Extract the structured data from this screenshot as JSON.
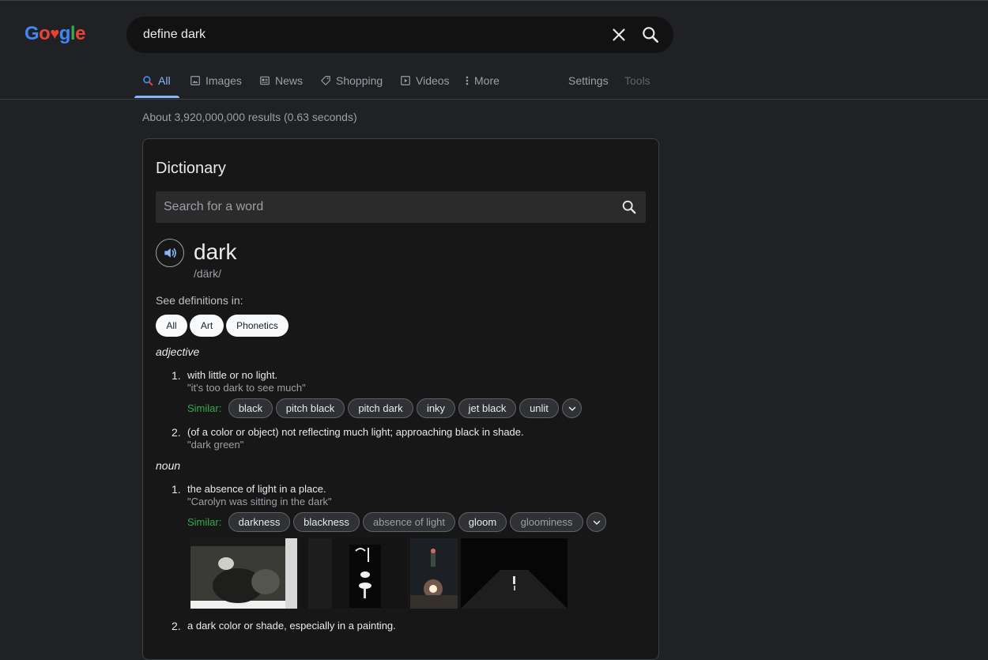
{
  "search": {
    "query": "define dark"
  },
  "tabs": [
    {
      "label": "All",
      "icon": "search-icon"
    },
    {
      "label": "Images",
      "icon": "image-icon"
    },
    {
      "label": "News",
      "icon": "news-icon"
    },
    {
      "label": "Shopping",
      "icon": "tag-icon"
    },
    {
      "label": "Videos",
      "icon": "play-icon"
    },
    {
      "label": "More",
      "icon": "more-vert-icon"
    }
  ],
  "tools": {
    "settings": "Settings",
    "tools": "Tools"
  },
  "results_count": "About 3,920,000,000 results (0.63 seconds)",
  "dictionary": {
    "title": "Dictionary",
    "search_placeholder": "Search for a word",
    "word": "dark",
    "phonetic": "/därk/",
    "see_definitions": "See definitions in:",
    "filters": [
      "All",
      "Art",
      "Phonetics"
    ],
    "similar_label": "Similar:",
    "adjective": {
      "label": "adjective",
      "defs": [
        {
          "num": "1.",
          "text": "with little or no light.",
          "example": "\"it's too dark to see much\"",
          "similar": [
            "black",
            "pitch black",
            "pitch dark",
            "inky",
            "jet black",
            "unlit"
          ]
        },
        {
          "num": "2.",
          "text": "(of a color or object) not reflecting much light; approaching black in shade.",
          "example": "\"dark green\""
        }
      ]
    },
    "noun": {
      "label": "noun",
      "defs": [
        {
          "num": "1.",
          "text": "the absence of light in a place.",
          "example": "\"Carolyn was sitting in the dark\"",
          "similar": [
            "darkness",
            "blackness",
            "absence of light",
            "gloom",
            "gloominess"
          ]
        },
        {
          "num": "2.",
          "text": "a dark color or shade, especially in a painting."
        }
      ]
    }
  },
  "colors": {
    "accent": "#8ab4f8",
    "similar_green": "#34a853",
    "background": "#202124",
    "card": "#171717"
  }
}
